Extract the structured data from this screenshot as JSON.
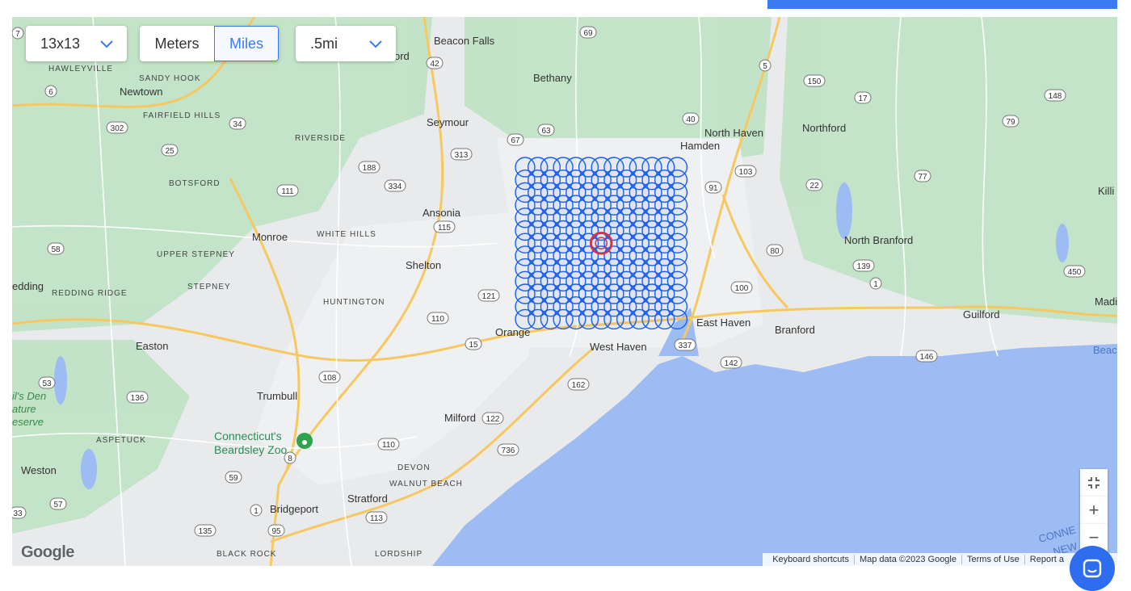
{
  "controls": {
    "grid_size": "13x13",
    "units": {
      "meters": "Meters",
      "miles": "Miles",
      "selected": "Miles"
    },
    "distance": ".5mi"
  },
  "grid": {
    "rows": 13,
    "cols": 13
  },
  "colors": {
    "accent": "#3b7bf2",
    "water": "#9dbcf4",
    "land": "#e8eaec",
    "park": "#bfe3c5",
    "grid_circle": "#1a5ff0",
    "center_marker": "#e0313a"
  },
  "map_labels": {
    "towns": [
      "Beacon Falls",
      "Bethany",
      "Newtown",
      "Seymour",
      "Hamden",
      "North Haven",
      "Northford",
      "Ansonia",
      "Monroe",
      "Shelton",
      "North Branford",
      "Orange",
      "West Haven",
      "East Haven",
      "Branford",
      "Guilford",
      "Easton",
      "Trumbull",
      "Milford",
      "Weston",
      "Stratford",
      "Bridgeport"
    ],
    "places": [
      "HAWLEYVILLE",
      "SANDY HOOK",
      "FAIRFIELD HILLS",
      "RIVERSIDE",
      "BOTSFORD",
      "WHITE HILLS",
      "UPPER STEPNEY",
      "STEPNEY",
      "REDDING RIDGE",
      "HUNTINGTON",
      "ASPETUCK",
      "DEVON",
      "WALNUT BEACH",
      "BLACK ROCK",
      "LORDSHIP"
    ],
    "partial": [
      "edding",
      "Madi",
      "Killi",
      "Beach",
      "il's Den",
      "ature",
      "eserve",
      "ord",
      "CONNE",
      "NEW",
      "Wallingford"
    ],
    "poi": [
      "Connecticut's",
      "Beardsley Zoo"
    ]
  },
  "routes": [
    "7",
    "6",
    "302",
    "34",
    "25",
    "111",
    "58",
    "53",
    "136",
    "59",
    "57",
    "33",
    "135",
    "8",
    "188",
    "334",
    "42",
    "69",
    "63",
    "67",
    "313",
    "115",
    "110",
    "108",
    "121",
    "15",
    "162",
    "122",
    "110",
    "736",
    "113",
    "1",
    "95",
    "91",
    "5",
    "150",
    "17",
    "103",
    "22",
    "40",
    "80",
    "100",
    "337",
    "142",
    "146",
    "139",
    "77",
    "79",
    "148",
    "450",
    "1"
  ],
  "attribution": {
    "shortcuts": "Keyboard shortcuts",
    "mapdata": "Map data ©2023 Google",
    "terms": "Terms of Use",
    "report": "Report a"
  },
  "logo": "Google",
  "icons": {
    "fullscreen": "fullscreen-exit-icon",
    "zoom_in": "plus-icon",
    "zoom_out": "minus-icon",
    "chat": "chat-icon"
  }
}
